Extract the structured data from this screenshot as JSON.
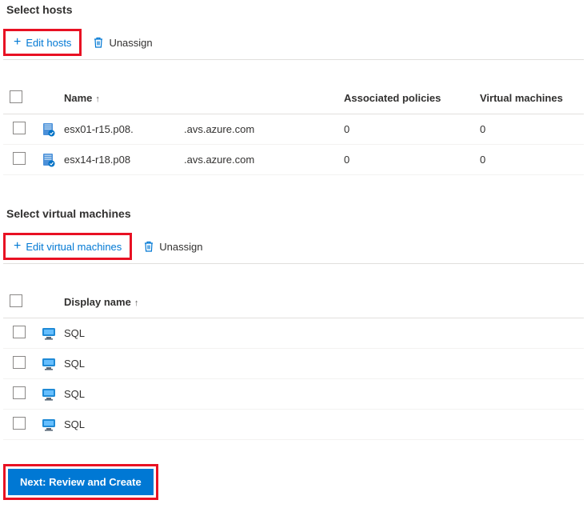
{
  "hosts": {
    "heading": "Select hosts",
    "toolbar": {
      "edit_label": "Edit hosts",
      "unassign_label": "Unassign"
    },
    "columns": {
      "name": "Name",
      "policies": "Associated policies",
      "vms": "Virtual machines"
    },
    "rows": [
      {
        "name": "esx01-r15.p08.",
        "domain": ".avs.azure.com",
        "policies": "0",
        "vms": "0"
      },
      {
        "name": "esx14-r18.p08",
        "domain": ".avs.azure.com",
        "policies": "0",
        "vms": "0"
      }
    ]
  },
  "vms": {
    "heading": "Select virtual machines",
    "toolbar": {
      "edit_label": "Edit virtual machines",
      "unassign_label": "Unassign"
    },
    "columns": {
      "display_name": "Display name"
    },
    "rows": [
      {
        "display_name": "SQL"
      },
      {
        "display_name": "SQL"
      },
      {
        "display_name": "SQL"
      },
      {
        "display_name": "SQL"
      }
    ]
  },
  "footer": {
    "next_label": "Next: Review and Create"
  }
}
